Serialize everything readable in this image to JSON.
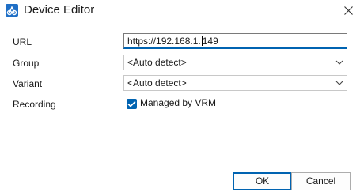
{
  "window": {
    "title": "Device Editor"
  },
  "form": {
    "url_label": "URL",
    "url_value": "https://192.168.1.149",
    "url_value_before_caret": "https://192.168.1.",
    "url_value_after_caret": "149",
    "group_label": "Group",
    "group_value": "<Auto detect>",
    "variant_label": "Variant",
    "variant_value": "<Auto detect>",
    "recording_label": "Recording",
    "recording_checkbox_label": "Managed by VRM",
    "recording_checked": true
  },
  "buttons": {
    "ok": "OK",
    "cancel": "Cancel"
  },
  "colors": {
    "accent": "#0063b1",
    "app_icon": "#1f6fc6"
  },
  "icons": {
    "app": "device-editor-app-icon",
    "close": "close-icon",
    "chevron": "chevron-down-icon",
    "check": "checkmark-icon"
  }
}
